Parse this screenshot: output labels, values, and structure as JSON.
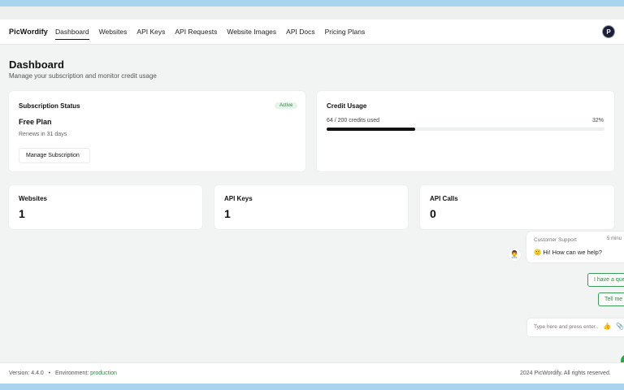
{
  "app": {
    "brand": "PicWordify",
    "avatar_initial": "P"
  },
  "nav": {
    "items": [
      {
        "label": "Dashboard",
        "active": true
      },
      {
        "label": "Websites"
      },
      {
        "label": "API Keys"
      },
      {
        "label": "API Requests"
      },
      {
        "label": "Website Images"
      },
      {
        "label": "API Docs"
      },
      {
        "label": "Pricing Plans"
      }
    ]
  },
  "page": {
    "title": "Dashboard",
    "subtitle": "Manage your subscription and monitor credit usage"
  },
  "subscription": {
    "title": "Subscription Status",
    "badge": "Active",
    "plan": "Free Plan",
    "renews": "Renews in 31 days",
    "manage_label": "Manage Subscription"
  },
  "credits": {
    "title": "Credit Usage",
    "used_text": "64 / 200 credits used",
    "percent_text": "32%",
    "progress": 0.32
  },
  "stats": [
    {
      "label": "Websites",
      "value": "1"
    },
    {
      "label": "API Keys",
      "value": "1"
    },
    {
      "label": "API Calls",
      "value": "0"
    }
  ],
  "chat": {
    "agent_name": "Customer Support",
    "time": "5 minu",
    "greeting": "🙂 Hi! How can we help?",
    "quick_replies": [
      "I have a que",
      "Tell me"
    ],
    "input_placeholder": "Type here and press enter.."
  },
  "footer": {
    "version_label": "Version:",
    "version": "4.4.0",
    "separator": "•",
    "env_label": "Environment:",
    "env": "production",
    "copyright": "2024 PicWordify. All rights reserved."
  },
  "colors": {
    "accent_green": "#2e8a45",
    "progress": "#111111",
    "band": "#a9d4ee"
  }
}
